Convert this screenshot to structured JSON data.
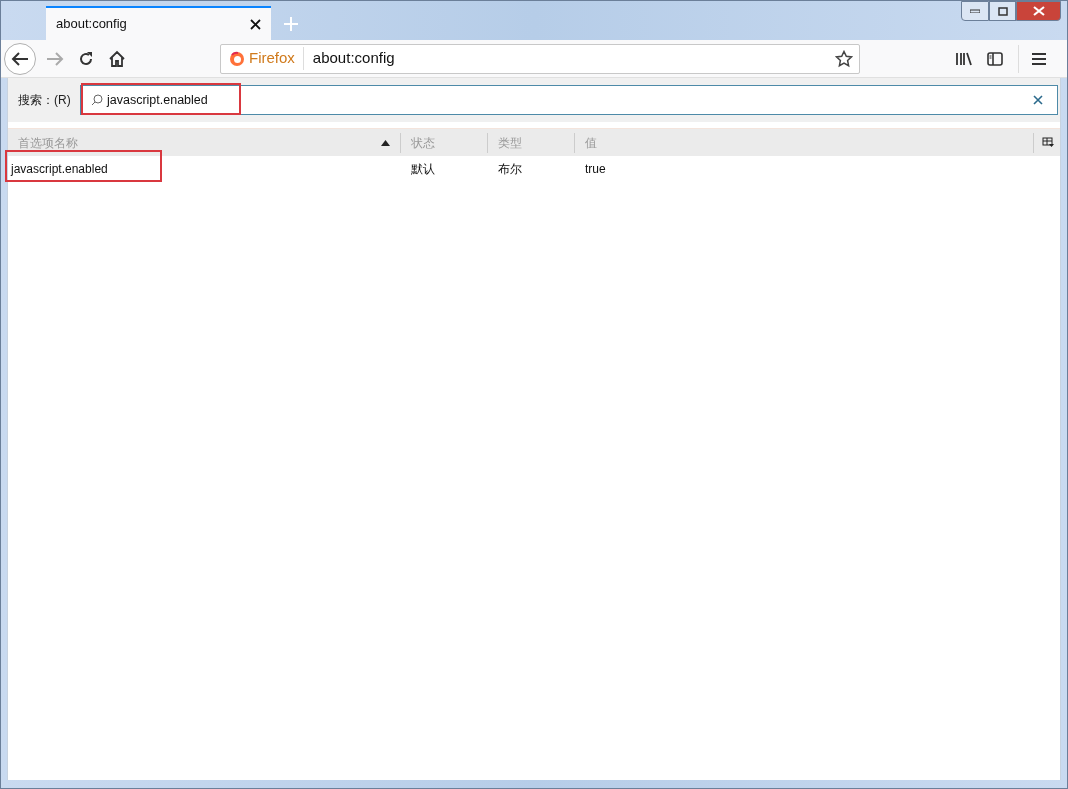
{
  "tabs": [
    {
      "title": "about:config",
      "selected": true
    }
  ],
  "address_bar": {
    "identity": "Firefox",
    "url": "about:config"
  },
  "search": {
    "label": "搜索：(R)",
    "value": "javascript.enabled",
    "highlighted": true
  },
  "table": {
    "columns": [
      {
        "label": "首选项名称",
        "sorted": true
      },
      {
        "label": "状态",
        "sorted": false
      },
      {
        "label": "类型",
        "sorted": false
      },
      {
        "label": "值",
        "sorted": false
      }
    ],
    "rows": [
      {
        "cells": [
          "javascript.enabled",
          "默认",
          "布尔",
          "true"
        ],
        "highlighted": true
      }
    ]
  }
}
